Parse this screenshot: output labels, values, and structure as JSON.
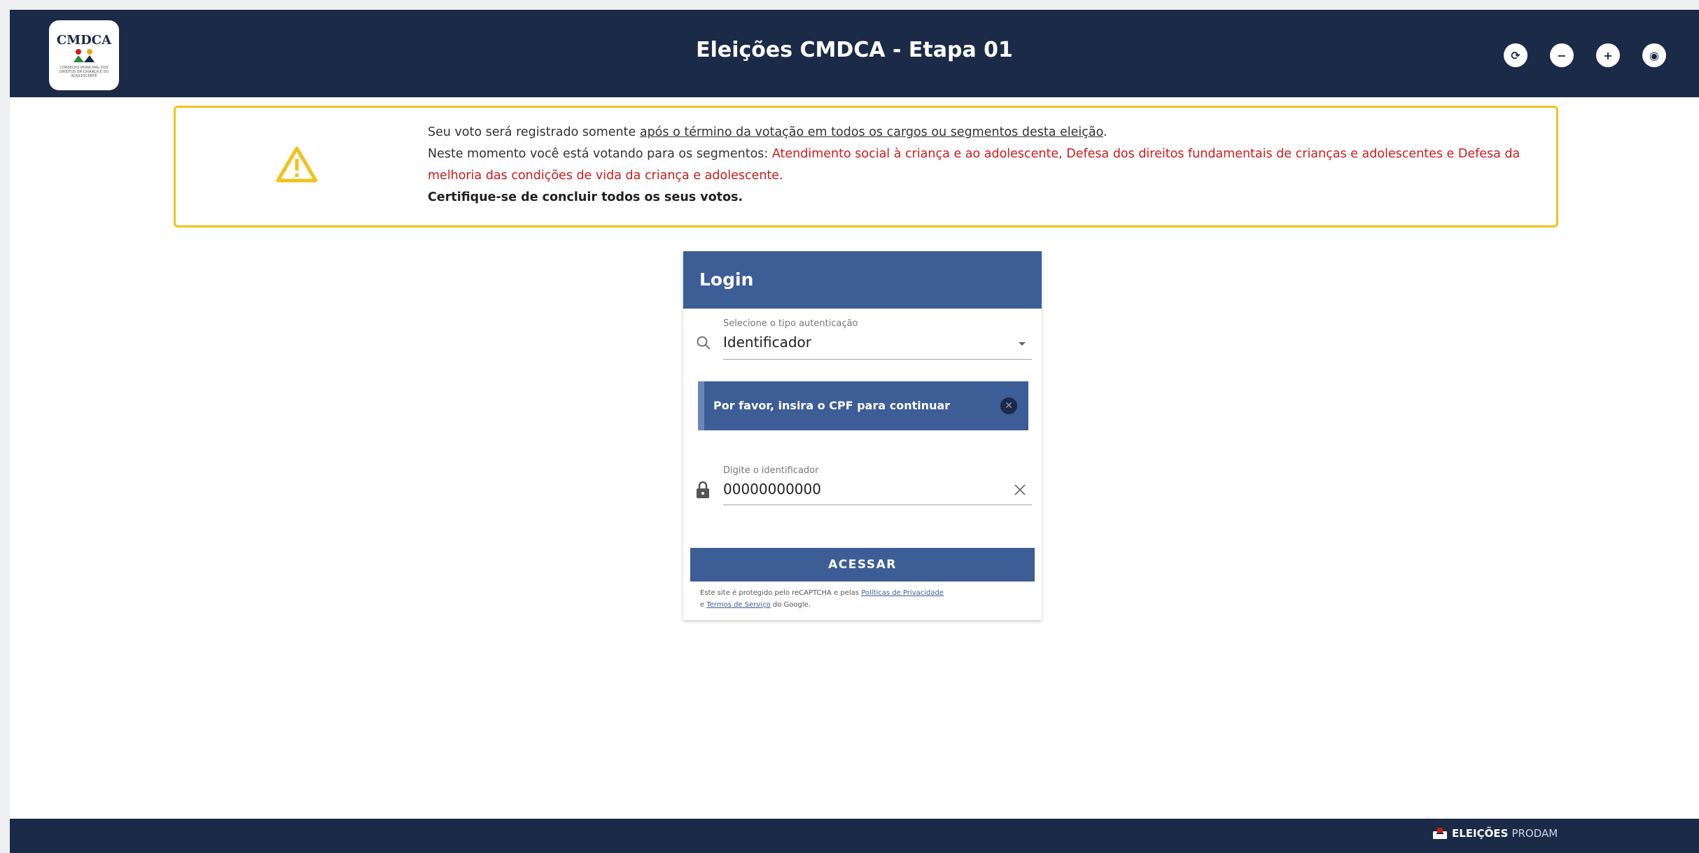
{
  "header": {
    "title": "Eleições CMDCA - Etapa 01",
    "logo_text": "CMDCA",
    "logo_subtext": "CONSELHO MUNICIPAL DOS DIREITOS DA CRIANÇA E DO ADOLESCENTE",
    "controls": [
      {
        "name": "refresh-contrast-button",
        "glyph": "⟳"
      },
      {
        "name": "decrease-font-button",
        "glyph": "−"
      },
      {
        "name": "increase-font-button",
        "glyph": "+"
      },
      {
        "name": "accessibility-view-button",
        "glyph": "◉"
      }
    ]
  },
  "banner": {
    "line1_prefix": "Seu voto será registrado somente ",
    "line1_underlined": "após o término da votação em todos os cargos ou segmentos desta eleição",
    "line1_suffix": ".",
    "line2_prefix": "Neste momento você está votando para os segmentos: ",
    "line2_segments": "Atendimento social à criança e ao adolescente, Defesa dos direitos fundamentais de crianças e adolescentes e Defesa da melhoria das condições de vida da criança e adolescente.",
    "line3": "Certifique-se de concluir todos os seus votos."
  },
  "login": {
    "title": "Login",
    "auth_type_label": "Selecione o tipo autenticação",
    "auth_type_value": "Identificador",
    "alert_text": "Por favor, insira o CPF para continuar",
    "id_label": "Digite o identificador",
    "id_value": "00000000000",
    "submit_label": "ACESSAR",
    "recaptcha_prefix": "Este site é protegido pelo reCAPTCHA e pelas ",
    "privacy_link": "Políticas de Privacidade",
    "recaptcha_middle": " e ",
    "terms_link": "Termos de Serviço",
    "recaptcha_suffix": " do Google."
  },
  "footer": {
    "brand_bold": "ELEIÇÕES",
    "brand_normal": "PRODAM"
  },
  "colors": {
    "navy": "#1b2a47",
    "primary": "#3d5d97",
    "warning": "#f2c21a",
    "segment_red": "#d11a1a"
  }
}
